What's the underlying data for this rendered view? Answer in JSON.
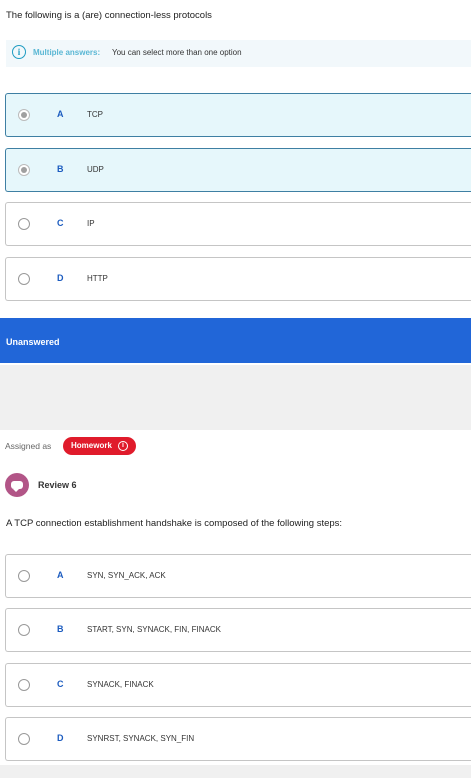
{
  "question1": {
    "text": "The following is a (are) connection-less protocols",
    "info_icon": "info-icon",
    "info_label": "Multiple answers:",
    "info_text": "You can select more than one option",
    "options": [
      {
        "letter": "A",
        "text": "TCP",
        "selected": true
      },
      {
        "letter": "B",
        "text": "UDP",
        "selected": true
      },
      {
        "letter": "C",
        "text": "IP",
        "selected": false
      },
      {
        "letter": "D",
        "text": "HTTP",
        "selected": false
      }
    ],
    "status": "Unanswered",
    "status_color": "#2166d8"
  },
  "question2": {
    "assigned_label": "Assigned as",
    "badge_label": "Homework",
    "badge_icon": "info-icon",
    "badge_color": "#e01b2b",
    "avatar_icon": "chat-icon",
    "review_label": "Review 6",
    "text": "A TCP connection establishment handshake is composed of the following steps:",
    "options": [
      {
        "letter": "A",
        "text": "SYN, SYN_ACK, ACK"
      },
      {
        "letter": "B",
        "text": "START, SYN, SYNACK, FIN, FINACK"
      },
      {
        "letter": "C",
        "text": "SYNACK, FINACK"
      },
      {
        "letter": "D",
        "text": "SYNRST, SYNACK, SYN_FIN"
      }
    ]
  }
}
